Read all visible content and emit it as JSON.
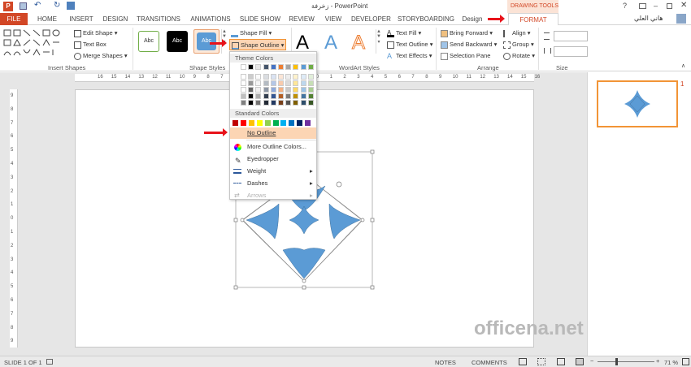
{
  "titlebar": {
    "title": "زخرفة - PowerPoint",
    "drawing_tools": "DRAWING TOOLS",
    "user": "هاني العلي",
    "help": "?"
  },
  "tabs": [
    "FILE",
    "HOME",
    "INSERT",
    "DESIGN",
    "TRANSITIONS",
    "ANIMATIONS",
    "SLIDE SHOW",
    "REVIEW",
    "VIEW",
    "DEVELOPER",
    "STORYBOARDING",
    "Design",
    "FORMAT"
  ],
  "ribbon": {
    "insert_shapes": {
      "label": "Insert Shapes",
      "edit_shape": "Edit Shape",
      "text_box": "Text Box",
      "merge_shapes": "Merge Shapes"
    },
    "shape_styles": {
      "label": "Shape Styles",
      "style1": "Abc",
      "style2": "Abc",
      "style3": "Abc",
      "shape_fill": "Shape Fill",
      "shape_outline": "Shape Outline"
    },
    "wordart": {
      "label": "WordArt Styles",
      "text_fill": "Text Fill",
      "text_outline": "Text Outline",
      "text_effects": "Text Effects",
      "letter": "A"
    },
    "arrange": {
      "label": "Arrange",
      "bring_forward": "Bring Forward",
      "send_backward": "Send Backward",
      "selection_pane": "Selection Pane",
      "align": "Align",
      "group": "Group",
      "rotate": "Rotate"
    },
    "size": {
      "label": "Size"
    }
  },
  "dropdown": {
    "theme_colors": "Theme Colors",
    "standard_colors": "Standard Colors",
    "no_outline": "No Outline",
    "more_colors": "More Outline Colors...",
    "eyedropper": "Eyedropper",
    "weight": "Weight",
    "dashes": "Dashes",
    "arrows": "Arrows",
    "theme_top": [
      "#ffffff",
      "#000000",
      "#e7e6e6",
      "#44546a",
      "#4472c4",
      "#ed7d31",
      "#a5a5a5",
      "#ffc000",
      "#5b9bd5",
      "#70ad47"
    ],
    "standard": [
      "#c00000",
      "#ff0000",
      "#ffc000",
      "#ffff00",
      "#92d050",
      "#00b050",
      "#00b0f0",
      "#0070c0",
      "#002060",
      "#7030a0"
    ]
  },
  "ruler": {
    "h_labels": [
      "16",
      "15",
      "14",
      "13",
      "12",
      "11",
      "10",
      "9",
      "8",
      "7",
      "6",
      "5",
      "4",
      "3",
      "2",
      "1",
      "0",
      "1",
      "2",
      "3",
      "4",
      "5",
      "6",
      "7",
      "8",
      "9",
      "10",
      "11",
      "12",
      "13",
      "14",
      "15",
      "16"
    ],
    "v_labels": [
      "9",
      "8",
      "7",
      "6",
      "5",
      "4",
      "3",
      "2",
      "1",
      "0",
      "1",
      "2",
      "3",
      "4",
      "5",
      "6",
      "7",
      "8",
      "9"
    ]
  },
  "thumbnail": {
    "number": "1"
  },
  "watermark": "officena.net",
  "status": {
    "slide": "SLIDE 1 OF 1",
    "notes": "NOTES",
    "comments": "COMMENTS",
    "zoom": "71 %"
  },
  "colors": {
    "accent": "#d24726",
    "shape_fill": "#5b9bd5",
    "red_arrow": "#e8121a"
  }
}
